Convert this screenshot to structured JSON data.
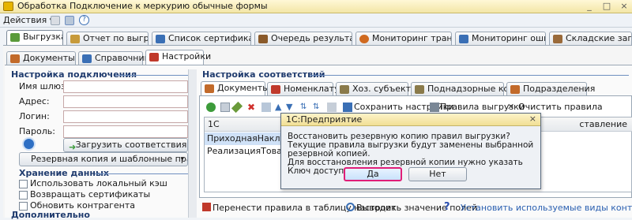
{
  "window": {
    "title": "Обработка  Подключение к меркурию обычные формы",
    "controls": [
      "_",
      "□",
      "×"
    ]
  },
  "menubar": {
    "actions_label": "Действия ▾",
    "help_label": "?"
  },
  "top_tabs": [
    {
      "label": "Выгрузка",
      "icon": "upload-icon",
      "color": "#5a9b3a",
      "active": true
    },
    {
      "label": "Отчет по выгрузке",
      "icon": "report-icon",
      "color": "#c79a3a"
    },
    {
      "label": "Список сертификатов...",
      "icon": "list-icon",
      "color": "#3a6fb5"
    },
    {
      "label": "Очередь результатов...",
      "icon": "queue-icon",
      "color": "#8a5a2a"
    },
    {
      "label": "Мониторинг транзак...",
      "icon": "monitor-icon",
      "color": "#d06a20"
    },
    {
      "label": "Мониторинг ошибок",
      "icon": "errors-icon",
      "color": "#3a6fb5"
    },
    {
      "label": "Складские записи",
      "icon": "warehouse-icon",
      "color": "#9a6a3a"
    }
  ],
  "second_tabs": [
    {
      "label": "Документы",
      "icon": "documents-icon",
      "color": "#c26a2a"
    },
    {
      "label": "Справочники",
      "icon": "catalogs-icon",
      "color": "#3a6fb5"
    },
    {
      "label": "Настройки",
      "icon": "settings-icon",
      "color": "#c0392b",
      "active": true
    }
  ],
  "connection": {
    "title": "Настройка подключения",
    "gateway_label": "Имя шлюза:",
    "address_label": "Адрес:",
    "login_label": "Логин:",
    "password_label": "Пароль:",
    "load_button": "Загрузить соответствия",
    "backup_select": "Резервная копия и шаблонные правил"
  },
  "storage": {
    "title": "Хранение данных",
    "use_cache": "Использовать локальный кэш",
    "return_certs": "Возвращать сертификаты",
    "update_contractor": "Обновить контрагента"
  },
  "extra": {
    "title": "Дополнительно"
  },
  "mapping": {
    "title": "Настройка соответствий",
    "tabs": [
      {
        "label": "Документы",
        "icon": "documents-icon",
        "color": "#c26a2a",
        "active": true
      },
      {
        "label": "Номенклатура",
        "icon": "nomenclature-icon",
        "color": "#c0392b"
      },
      {
        "label": "Хоз. субъекты",
        "icon": "entities-icon",
        "color": "#8a7a4a"
      },
      {
        "label": "Поднадзорные контр.",
        "icon": "controlled-icon",
        "color": "#8a7a4a"
      },
      {
        "label": "Подразделения",
        "icon": "departments-icon",
        "color": "#c26a2a"
      }
    ],
    "toolbar": {
      "save_settings": "Сохранить настройки",
      "upload_rules": "Правила выгрузки",
      "clear_rules": "Очистить правила"
    },
    "table": {
      "col1": "1С",
      "col_last": "ставление",
      "rows": [
        "ПриходнаяНакладная",
        "РеализацияТоваровУс"
      ]
    },
    "bottom": {
      "transfer": "Перенести правила в таблицу настроек",
      "show_fields": "Выводить значение полей",
      "install_types": "Установить используемые виды конт. инф."
    }
  },
  "dialog": {
    "title": "1С:Предприятие",
    "message_line1": "Восстановить резервную копию правил выгрузки?",
    "message_line2": "Текущие правила выгрузки будут заменены выбранной резервной копией.",
    "message_line3": "Для восстановления резервной копии нужно указать Ключ доступа.",
    "yes": "Да",
    "no": "Нет",
    "close": "×"
  }
}
